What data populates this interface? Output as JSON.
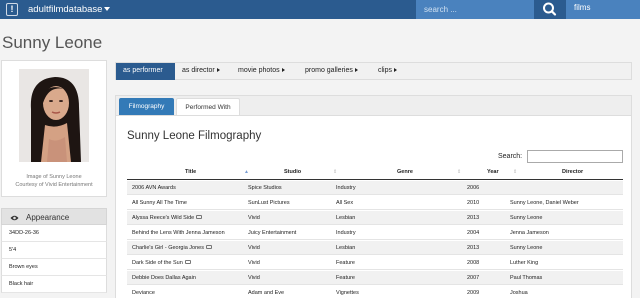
{
  "topbar": {
    "logo_glyph": "!",
    "site_name": "adultfilmdatabase",
    "search_placeholder": "search ...",
    "search_icon": "magnifier-icon",
    "scope": "films"
  },
  "page_title": "Sunny Leone",
  "photo_caption_line1": "Image of Sunny Leone",
  "photo_caption_line2": "Courtesy of Vivid Entertainment",
  "appearance": {
    "heading": "Appearance",
    "icon": "eye-icon",
    "items": [
      "34DD-26-36",
      "5'4",
      "Brown eyes",
      "Black hair"
    ]
  },
  "main_tabs": [
    "as performer",
    "as director",
    "movie photos",
    "promo galleries",
    "clips"
  ],
  "sub_tabs": [
    "Filmography",
    "Performed With"
  ],
  "filmography_title": "Sunny Leone Filmography",
  "search_label": "Search:",
  "table": {
    "headers": [
      "Title",
      "Studio",
      "Genre",
      "Year",
      "Director"
    ],
    "rows": [
      [
        "2006 AVN Awards",
        "Spice Studios",
        "Industry",
        "2006",
        ""
      ],
      [
        "All Sunny All The Time",
        "SunLust Pictures",
        "All Sex",
        "2010",
        "Sunny Leone, Daniel Weber"
      ],
      [
        "Alyssa Reece's Wild Side",
        "Vivid",
        "Lesbian",
        "2013",
        "Sunny Leone"
      ],
      [
        "Behind the Lens With Jenna Jameson",
        "Juicy Entertainment",
        "Industry",
        "2004",
        "Jenna Jameson"
      ],
      [
        "Charlie's Girl - Georgia Jones",
        "Vivid",
        "Lesbian",
        "2013",
        "Sunny Leone"
      ],
      [
        "Dark Side of the Sun",
        "Vivid",
        "Feature",
        "2008",
        "Luther King"
      ],
      [
        "Debbie Does Dallas Again",
        "Vivid",
        "Feature",
        "2007",
        "Paul Thomas"
      ],
      [
        "Deviance",
        "Adam and Eve",
        "Vignettes",
        "2009",
        "Joshua"
      ]
    ],
    "camera_rows": [
      2,
      4,
      5
    ]
  },
  "colors": {
    "nav_blue": "#2b5b8f",
    "nav_light_blue": "#4a82be",
    "tab_active": "#337ab7"
  }
}
